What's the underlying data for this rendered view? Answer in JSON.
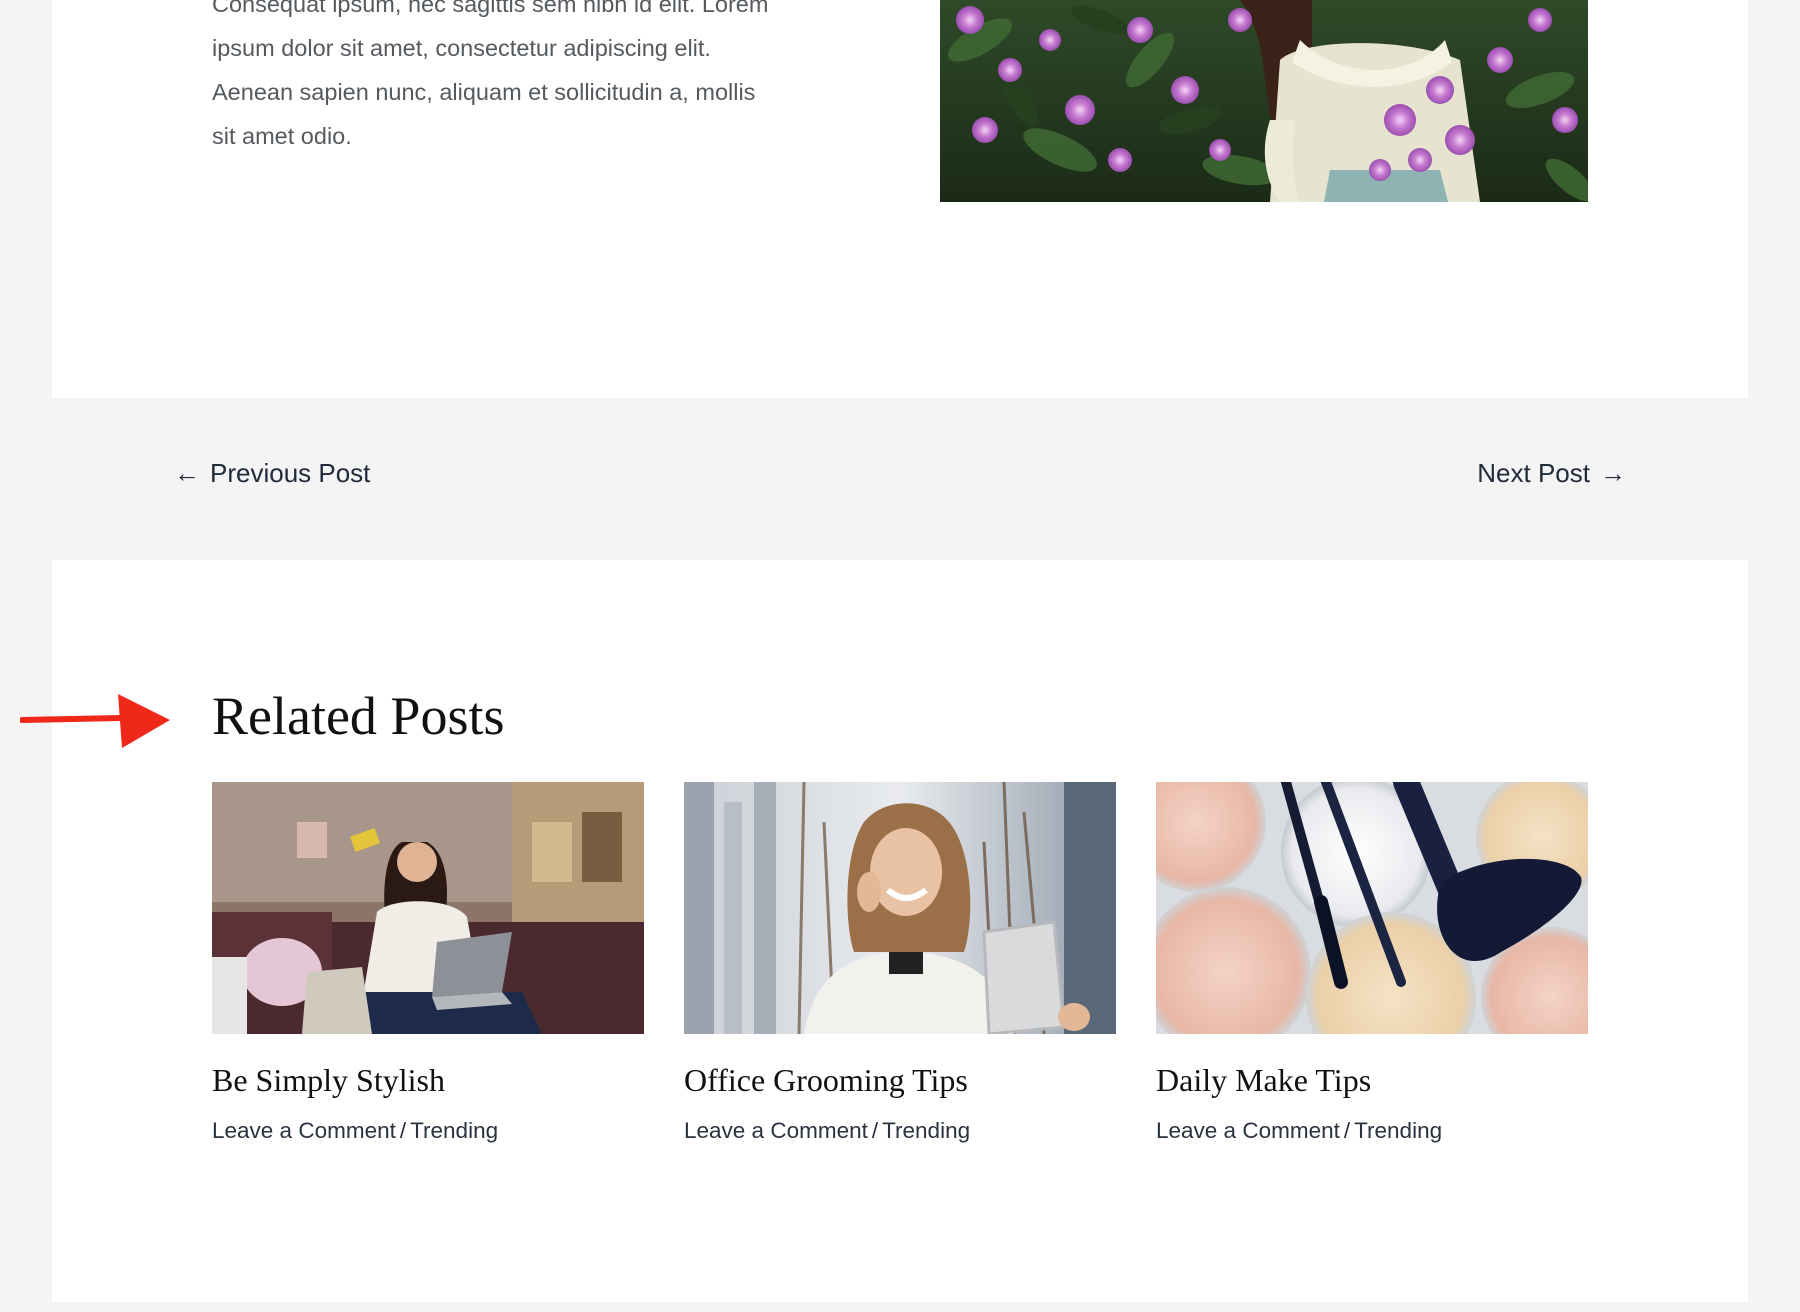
{
  "article": {
    "lines": [
      "Consequat ipsum, nec sagittis sem nibh id elit. Lorem",
      "ipsum dolor sit amet, consectetur adipiscing elit.",
      "Aenean sapien nunc, aliquam et sollicitudin a, mollis",
      "sit amet odio."
    ],
    "image_icon": "woman-with-purple-flowers-photo"
  },
  "post_navigation": {
    "previous_arrow": "←",
    "previous_label": "Previous Post",
    "next_label": "Next Post",
    "next_arrow": "→"
  },
  "related": {
    "title": "Related Posts",
    "posts": [
      {
        "title": "Be Simply Stylish",
        "comment_link": "Leave a Comment",
        "separator": "/",
        "category": "Trending",
        "image_icon": "woman-shopping-online-photo"
      },
      {
        "title": "Office Grooming Tips",
        "comment_link": "Leave a Comment",
        "separator": "/",
        "category": "Trending",
        "image_icon": "woman-on-phone-with-tablet-photo"
      },
      {
        "title": "Daily Make Tips",
        "comment_link": "Leave a Comment",
        "separator": "/",
        "category": "Trending",
        "image_icon": "makeup-powders-and-brushes-photo"
      }
    ]
  },
  "annotation": {
    "arrow_color": "#f0281a"
  },
  "colors": {
    "page_background": "#f4f4f4",
    "card_background": "#ffffff",
    "link_text": "#222b3b",
    "body_text": "#555a5f"
  }
}
